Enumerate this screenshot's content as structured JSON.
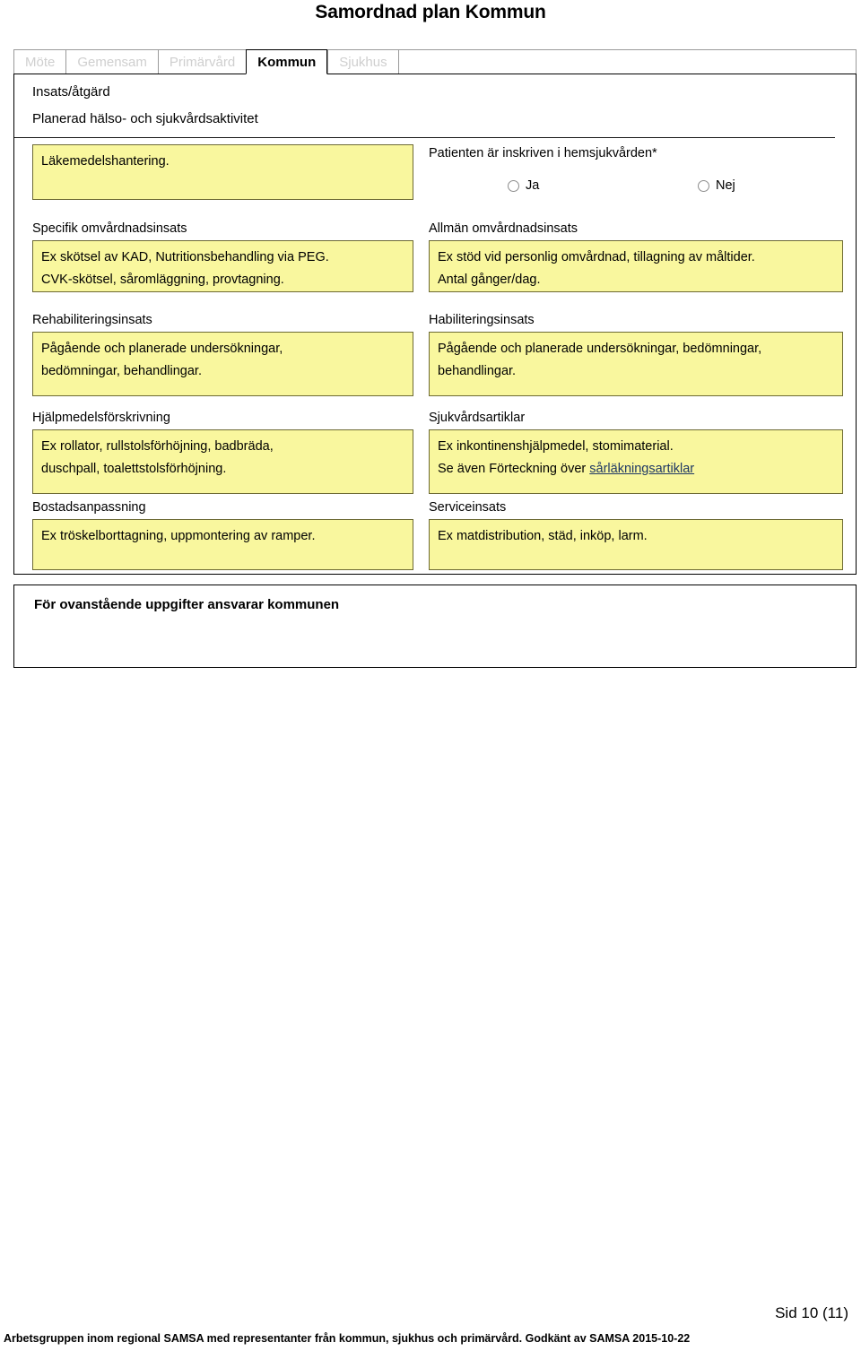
{
  "document": {
    "title": "Samordnad plan Kommun",
    "page_number": "Sid 10 (11)",
    "footer_note": "Arbetsgruppen inom regional SAMSA med representanter från kommun, sjukhus och primärvård. Godkänt av SAMSA 2015-10-22"
  },
  "colors": {
    "field_background": "#F9F79E",
    "field_border": "#6d6a34",
    "tab_inactive_text": "#cfcfcf",
    "link": "#1F3864"
  },
  "tabs": [
    {
      "label": "Möte",
      "active": false
    },
    {
      "label": "Gemensam",
      "active": false
    },
    {
      "label": "Primärvård",
      "active": false
    },
    {
      "label": "Kommun",
      "active": true
    },
    {
      "label": "Sjukhus",
      "active": false
    }
  ],
  "form": {
    "heading_1": "Insats/åtgärd",
    "heading_2": "Planerad hälso- och sjukvårdsaktivitet",
    "medication_field": {
      "label": "",
      "value": "Läkemedelshantering."
    },
    "home_care_question": {
      "text": "Patienten är inskriven i hemsjukvården*",
      "options": [
        {
          "label": "Ja",
          "selected": false
        },
        {
          "label": "Nej",
          "selected": false
        }
      ]
    },
    "fields": [
      {
        "label": "Specifik omvårdnadsinsats",
        "lines": [
          "Ex skötsel av KAD, Nutritionsbehandling via PEG.",
          "CVK-skötsel, såromläggning, provtagning."
        ]
      },
      {
        "label": "Allmän omvårdnadsinsats",
        "lines": [
          "Ex stöd vid personlig omvårdnad, tillagning av måltider.",
          "Antal gånger/dag."
        ]
      },
      {
        "label": "Rehabiliteringsinsats",
        "lines": [
          "Pågående och planerade undersökningar,",
          "bedömningar, behandlingar."
        ]
      },
      {
        "label": "Habiliteringsinsats",
        "lines": [
          "Pågående och planerade undersökningar, bedömningar,",
          "behandlingar."
        ]
      },
      {
        "label": "Hjälpmedelsförskrivning",
        "lines": [
          "Ex rollator, rullstolsförhöjning, badbräda,",
          "duschpall, toalettstolsförhöjning."
        ]
      },
      {
        "label": "Sjukvårdsartiklar",
        "lines": [
          "Ex inkontinenshjälpmedel, stomimaterial.",
          "Se även Förteckning över "
        ],
        "link_text": "sårläkningsartiklar"
      },
      {
        "label": "Bostadsanpassning",
        "lines": [
          "Ex tröskelborttagning, uppmontering av ramper."
        ]
      },
      {
        "label": "Serviceinsats",
        "lines": [
          "Ex matdistribution, städ, inköp, larm."
        ]
      }
    ],
    "responsibility_text": "För ovanstående uppgifter ansvarar kommunen"
  }
}
